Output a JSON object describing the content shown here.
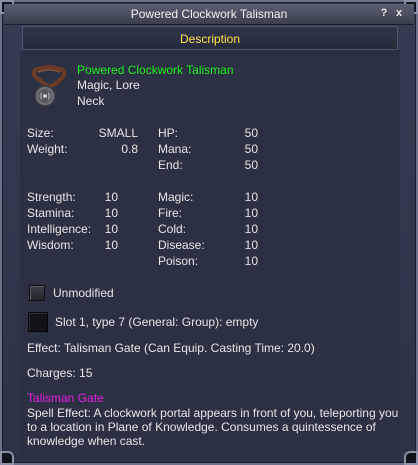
{
  "window": {
    "title": "Powered Clockwork Talisman",
    "help_glyph": "?",
    "close_glyph": "x"
  },
  "description": {
    "header": "Description"
  },
  "item": {
    "name": "Powered Clockwork Talisman",
    "flags": "Magic, Lore",
    "slot": "Neck",
    "icon": "talisman-icon"
  },
  "stats_left": [
    {
      "label": "Size:",
      "value": "SMALL"
    },
    {
      "label": "Weight:",
      "value": "0.8"
    }
  ],
  "stats_right": [
    {
      "label": "HP:",
      "value": "50"
    },
    {
      "label": "Mana:",
      "value": "50"
    },
    {
      "label": "End:",
      "value": "50"
    }
  ],
  "attributes": [
    {
      "label": "Strength:",
      "value": "10"
    },
    {
      "label": "Stamina:",
      "value": "10"
    },
    {
      "label": "Intelligence:",
      "value": "10"
    },
    {
      "label": "Wisdom:",
      "value": "10"
    }
  ],
  "resists": [
    {
      "label": "Magic:",
      "value": "10"
    },
    {
      "label": "Fire:",
      "value": "10"
    },
    {
      "label": "Cold:",
      "value": "10"
    },
    {
      "label": "Disease:",
      "value": "10"
    },
    {
      "label": "Poison:",
      "value": "10"
    }
  ],
  "unmodified_label": "Unmodified",
  "slot_info": "Slot 1, type 7 (General: Group): empty",
  "effect_line": "Effect: Talisman Gate (Can Equip. Casting Time: 20.0)",
  "charges_line": "Charges: 15",
  "spell": {
    "name": "Talisman Gate",
    "description": "Spell Effect: A clockwork portal appears in front of you, teleporting you to a location in Plane of Knowledge. Consumes a quintessence of knowledge when cast."
  },
  "colors": {
    "title_text": "#ffe14a",
    "item_name": "#19ef1f",
    "spell_name": "#e61fe6",
    "panel_bg": "#2b3143"
  }
}
